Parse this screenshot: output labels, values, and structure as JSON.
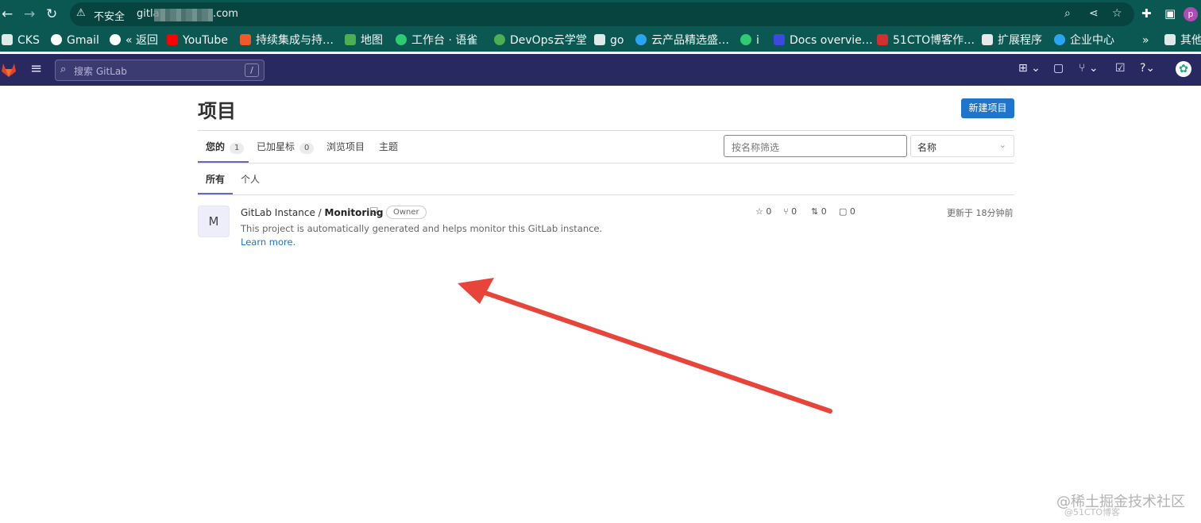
{
  "browser": {
    "address_warning": "不安全",
    "url_prefix": "gitla",
    "url_suffix": ".com",
    "profile_initial": "p",
    "bookmarks": [
      {
        "label": "CKS",
        "icon": "folder-icon"
      },
      {
        "label": "Gmail",
        "icon": "google-icon"
      },
      {
        "label": "« 返回",
        "icon": "globe-icon"
      },
      {
        "label": "YouTube",
        "icon": "youtube-icon"
      },
      {
        "label": "持续集成与持…",
        "icon": "c-icon"
      },
      {
        "label": "地图",
        "icon": "maps-icon"
      },
      {
        "label": "工作台 · 语雀",
        "icon": "yuque-icon"
      },
      {
        "label": "DevOps云学堂",
        "icon": "devops-icon"
      },
      {
        "label": "go",
        "icon": "folder-icon"
      },
      {
        "label": "云产品精选盛…",
        "icon": "cloud-icon"
      },
      {
        "label": "i",
        "icon": "i-icon"
      },
      {
        "label": "Docs overvie…",
        "icon": "docs-icon"
      },
      {
        "label": "51CTO博客作…",
        "icon": "51cto-icon"
      },
      {
        "label": "扩展程序",
        "icon": "puzzle-icon"
      },
      {
        "label": "企业中心",
        "icon": "cloud-icon"
      }
    ],
    "more_bookmarks": "»",
    "other_bookmarks": "其他"
  },
  "gitlab_nav": {
    "search_placeholder": "搜索 GitLab",
    "search_shortcut": "/"
  },
  "page": {
    "title": "项目",
    "new_project_button": "新建项目",
    "tabs": [
      {
        "label": "您的",
        "count": "1"
      },
      {
        "label": "已加星标",
        "count": "0"
      },
      {
        "label": "浏览项目"
      },
      {
        "label": "主题"
      }
    ],
    "filter_placeholder": "按名称筛选",
    "sort_value": "名称",
    "subtabs": [
      "所有",
      "个人"
    ]
  },
  "project": {
    "avatar_letter": "M",
    "namespace": "GitLab Instance / ",
    "name": "Monitoring",
    "role_badge": "Owner",
    "description": "This project is automatically generated and helps monitor this GitLab instance.",
    "learn_more": "Learn more.",
    "stars": "0",
    "forks": "0",
    "merge_requests": "0",
    "issues": "0",
    "updated": "更新于 18分钟前"
  },
  "watermark": {
    "text": "@稀土掘金技术社区",
    "sub": "@51CTO博客"
  },
  "colors": {
    "chrome_bg": "#0b5752",
    "gitlab_nav_bg": "#292961",
    "primary_button": "#1f75cb",
    "annotation_arrow": "#e8443a"
  }
}
